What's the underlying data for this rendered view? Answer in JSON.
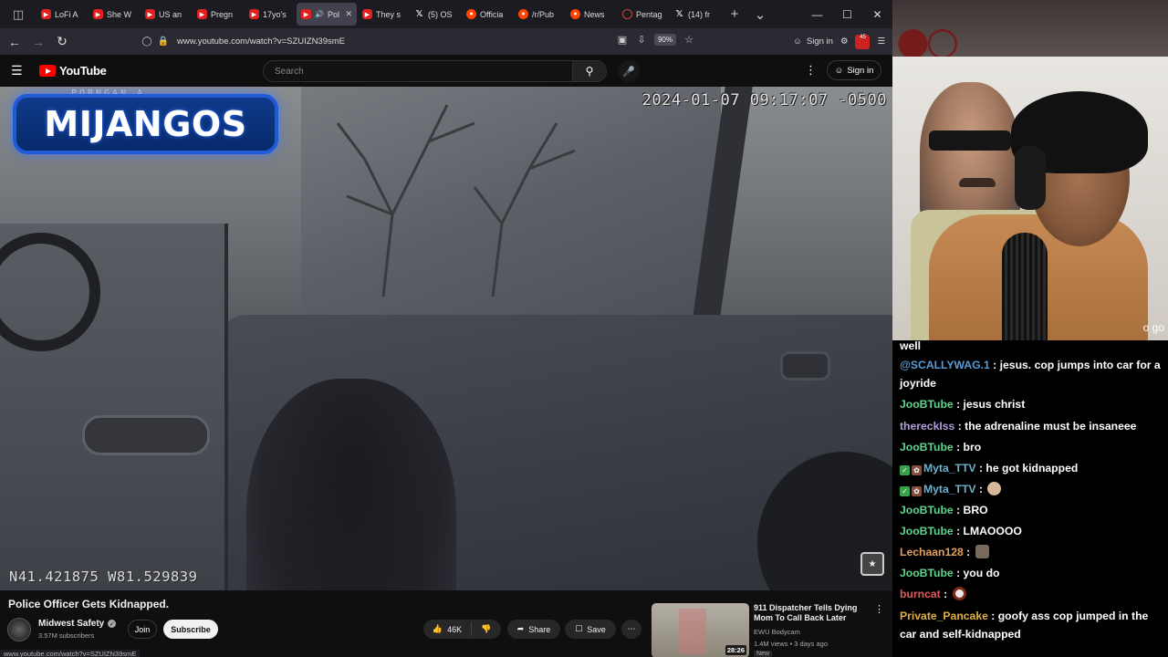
{
  "browser": {
    "tabs": [
      {
        "title": "LoFi A",
        "favicon": "youtube-icon",
        "active": false
      },
      {
        "title": "She W",
        "favicon": "youtube-icon",
        "active": false
      },
      {
        "title": "US an",
        "favicon": "youtube-icon",
        "active": false
      },
      {
        "title": "Pregn",
        "favicon": "youtube-icon",
        "active": false
      },
      {
        "title": "17yo's",
        "favicon": "youtube-icon",
        "active": false
      },
      {
        "title": "Poli",
        "favicon": "youtube-icon",
        "active": true
      },
      {
        "title": "They s",
        "favicon": "youtube-icon",
        "active": false
      },
      {
        "title": "(5) OS",
        "favicon": "x-icon",
        "active": false
      },
      {
        "title": "Officia",
        "favicon": "reddit-icon",
        "active": false
      },
      {
        "title": "/r/Pub",
        "favicon": "reddit-icon",
        "active": false
      },
      {
        "title": "News",
        "favicon": "reddit-icon",
        "active": false
      },
      {
        "title": "Pentag",
        "favicon": "pentagon-icon",
        "active": false
      },
      {
        "title": "(14) fr",
        "favicon": "x-icon",
        "active": false
      }
    ],
    "url": "www.youtube.com/watch?v=SZUIZN39smE",
    "zoom": "90%",
    "sign_in": "Sign in",
    "extension_badge": "45",
    "status_url": "www.youtube.com/watch?v=SZUIZN39smE"
  },
  "youtube": {
    "logo_text": "YouTube",
    "search_placeholder": "Search",
    "sign_in": "Sign in"
  },
  "video": {
    "overlay_name": "MIJANGOS",
    "timestamp": "2024-01-07 09:17:07 -0500",
    "gps": "N41.421875 W81.529839",
    "top_partial_text": "PORNGAN A"
  },
  "below_video": {
    "title": "Police Officer Gets Kidnapped.",
    "channel_name": "Midwest Safety",
    "subscribers": "3.57M subscribers",
    "join_label": "Join",
    "subscribe_label": "Subscribe",
    "likes": "46K",
    "share_label": "Share",
    "save_label": "Save"
  },
  "recommended": {
    "title": "911 Dispatcher Tells Dying Mom To Call Back Later",
    "channel": "EWU Bodycam",
    "meta": "1.4M views • 3 days ago",
    "badge": "New",
    "duration": "28:26"
  },
  "webcam": {
    "caption_fragment": "o go"
  },
  "chat": [
    {
      "user": "",
      "text": "well",
      "color": "#ffffff",
      "badges": []
    },
    {
      "user": "@SCALLYWAG.1",
      "text": " : jesus. cop jumps into car for a joyride",
      "color": "#5b9bd5",
      "badges": []
    },
    {
      "user": "JooBTube",
      "text": " : jesus christ",
      "color": "#5fd38d",
      "badges": []
    },
    {
      "user": "thereckIss",
      "text": " : the adrenaline must be insaneee",
      "color": "#b39ddb",
      "badges": []
    },
    {
      "user": "JooBTube",
      "text": " : bro",
      "color": "#5fd38d",
      "badges": []
    },
    {
      "user": "Myta_TTV",
      "text": " : he got kidnapped",
      "color": "#6fb1c9",
      "badges": [
        "check",
        "flower"
      ]
    },
    {
      "user": "Myta_TTV",
      "text": " : ",
      "color": "#6fb1c9",
      "badges": [
        "check",
        "flower"
      ],
      "emote": "hand"
    },
    {
      "user": "JooBTube",
      "text": " : BRO",
      "color": "#5fd38d",
      "badges": []
    },
    {
      "user": "JooBTube",
      "text": " : LMAOOOO",
      "color": "#5fd38d",
      "badges": []
    },
    {
      "user": "Lechaan128",
      "text": " : ",
      "color": "#e0a060",
      "badges": [],
      "emote": "face"
    },
    {
      "user": "JooBTube",
      "text": " : you do",
      "color": "#5fd38d",
      "badges": []
    },
    {
      "user": "burncat",
      "text": " : ",
      "color": "#e05a5a",
      "badges": [],
      "emote": "ball"
    },
    {
      "user": "Private_Pancake",
      "text": " : goofy ass cop jumped in the car and self-kidnapped",
      "color": "#e0b040",
      "badges": []
    }
  ]
}
